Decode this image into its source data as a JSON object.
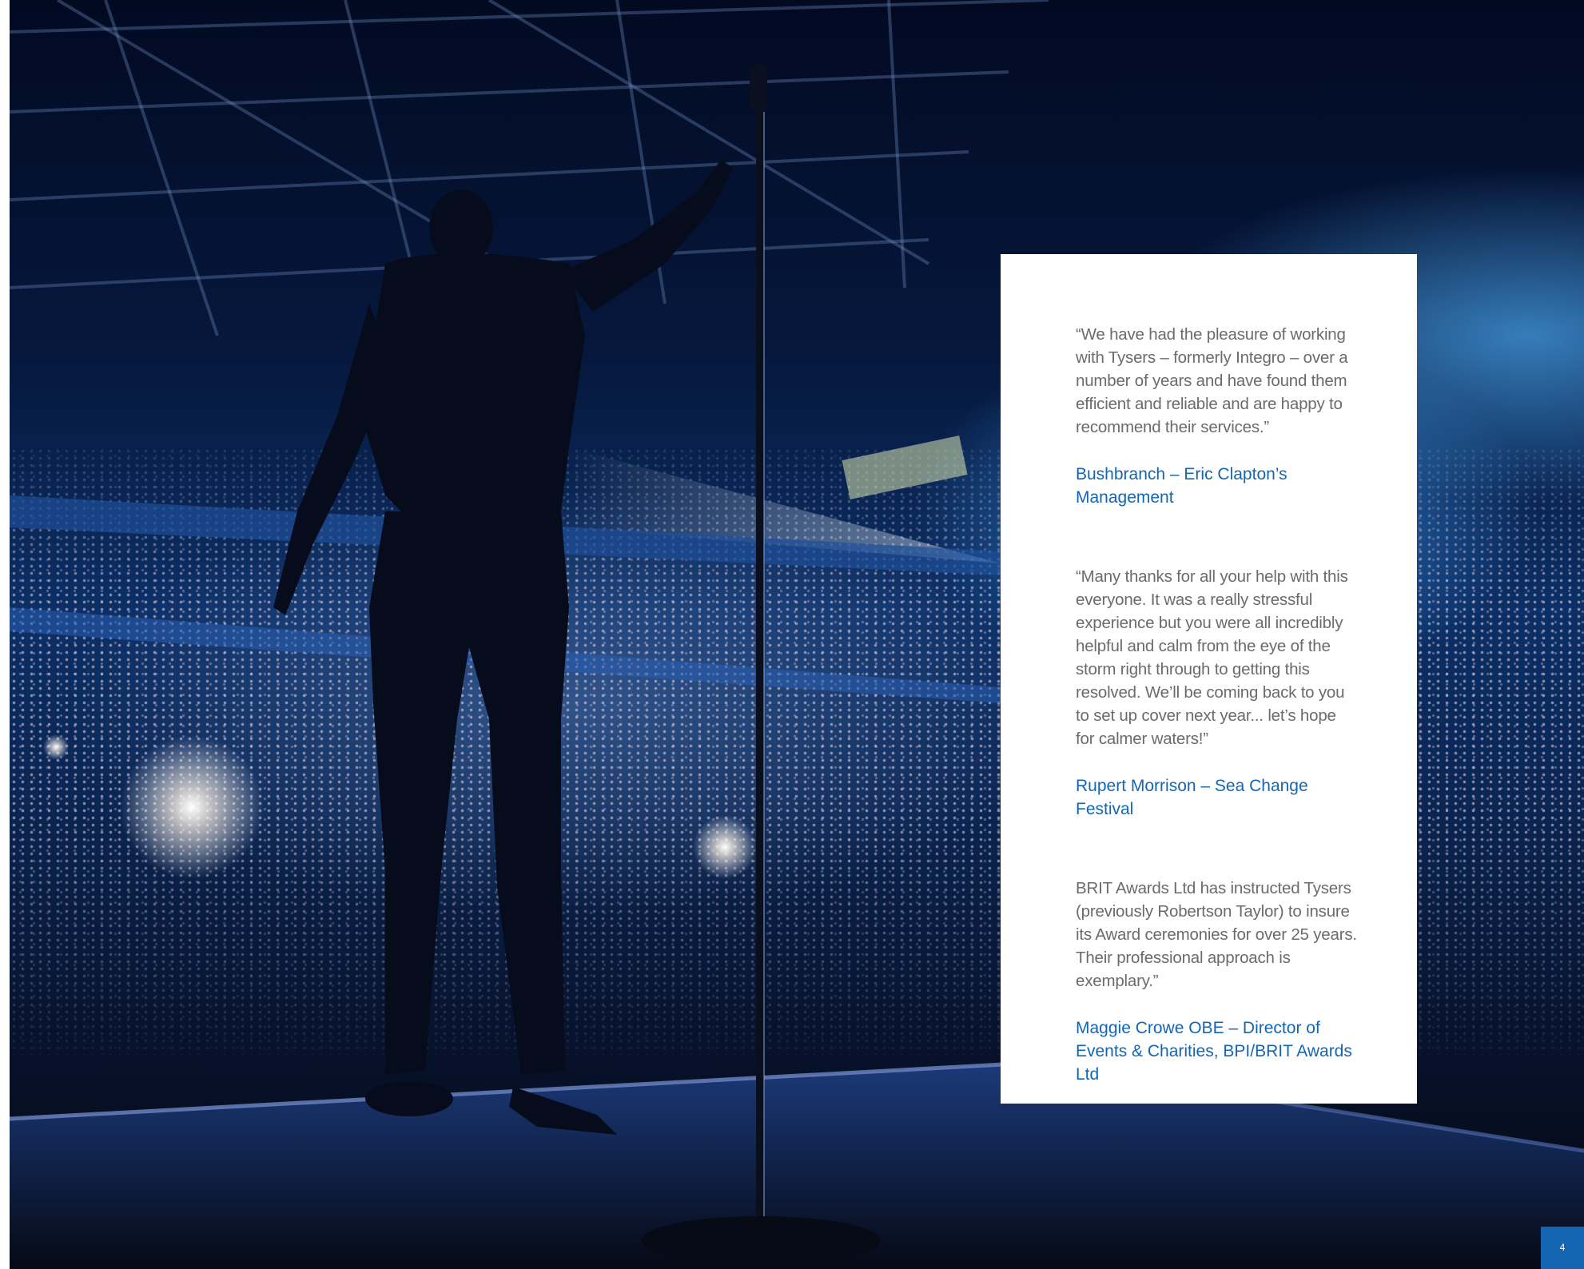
{
  "testimonials": [
    {
      "quote": "“We have had the pleasure of working with Tysers – formerly Integro – over a number of years and have found them efficient and reliable and are happy to recommend their services.”",
      "attribution": "Bushbranch – Eric Clapton’s Management"
    },
    {
      "quote": "“Many thanks for all your help with this everyone. It was a really stressful experience but you were all incredibly helpful and calm from the eye of the storm right through to getting this resolved. We’ll be coming back to you to set up cover next year... let’s hope for calmer waters!”",
      "attribution": "Rupert Morrison – Sea Change Festival"
    },
    {
      "quote": "BRIT Awards Ltd has instructed Tysers (previously Robertson Taylor) to insure its Award ceremonies for over 25 years. Their professional approach is exemplary.”",
      "attribution": "Maggie Crowe OBE – Director of Events & Charities, BPI/BRIT Awards Ltd"
    }
  ],
  "page_number": "4",
  "colors": {
    "accent": "#1466b3",
    "quote_text": "#6b6b6b",
    "panel": "#ffffff"
  }
}
